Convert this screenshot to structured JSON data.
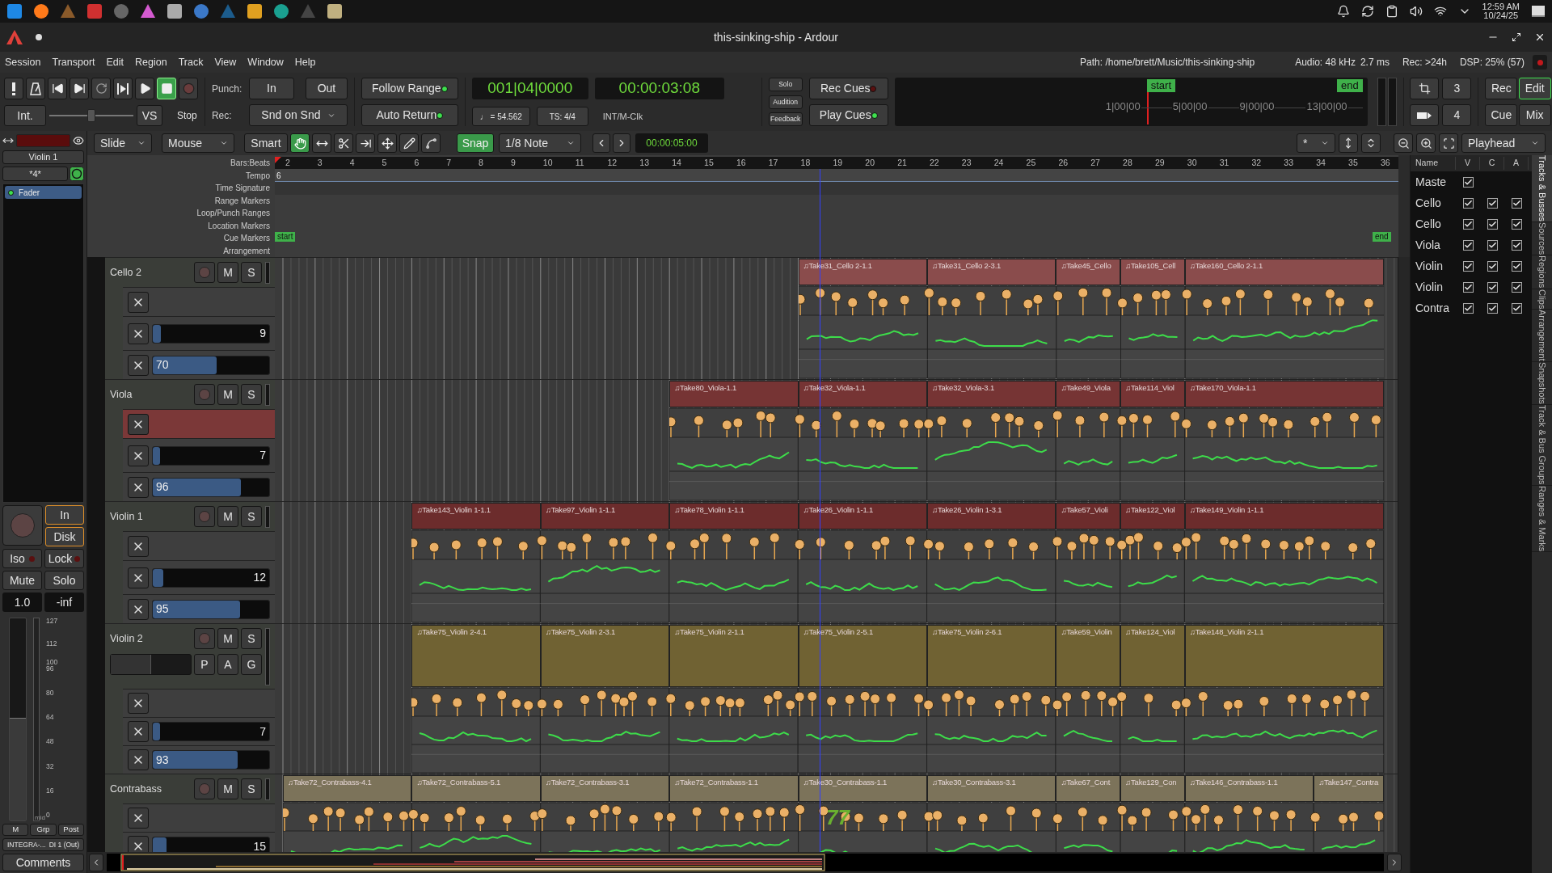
{
  "taskbar": {
    "time": "12:59 AM",
    "date": "10/24/25"
  },
  "window": {
    "title": "this-sinking-ship - Ardour"
  },
  "menu": [
    "Session",
    "Transport",
    "Edit",
    "Region",
    "Track",
    "View",
    "Window",
    "Help"
  ],
  "status": {
    "path": "Path: /home/brett/Music/this-sinking-ship",
    "audio": "Audio: 48 kHz",
    "latency": "2.7 ms",
    "rec": "Rec: >24h",
    "dsp": "DSP: 25% (57)"
  },
  "transport": {
    "buttons": [
      {
        "kind": "panic",
        "active": false
      },
      {
        "kind": "metronome",
        "active": false
      },
      {
        "kind": "to-start",
        "active": false
      },
      {
        "kind": "to-end",
        "active": false
      },
      {
        "kind": "loop",
        "active": false
      },
      {
        "kind": "play-range",
        "active": false
      },
      {
        "kind": "play",
        "active": false
      },
      {
        "kind": "stop",
        "active": true
      },
      {
        "kind": "record",
        "active": false
      }
    ],
    "sync_button": "Int.",
    "shuttle": {
      "level": 0.5
    },
    "vs_button": "VS",
    "shuttle_state": "Stop",
    "punch_label": "Punch:",
    "punch_in": "In",
    "punch_out": "Out",
    "rec_label": "Rec:",
    "rec_mode": "Snd on Snd",
    "follow_range": {
      "label": "Follow Range",
      "on": true
    },
    "auto_return": {
      "label": "Auto Return",
      "on": true
    },
    "primary_clock": "001|04|0000",
    "secondary_clock": "00:00:03:08",
    "tempo": "♩ = 54.562",
    "meter": "TS: 4/4",
    "sync_source": "INT/M-Clk",
    "monitor_buttons": [
      "Solo",
      "Audition",
      "Feedback"
    ],
    "rec_cues": {
      "label": "Rec Cues",
      "on": false
    },
    "play_cues": {
      "label": "Play Cues",
      "on": true
    },
    "mini_timeline": {
      "start": "start",
      "end": "end",
      "ticks": [
        "1|00|00",
        "5|00|00",
        "9|00|00",
        "13|00|00"
      ]
    },
    "slot_buttons": [
      "3",
      "4"
    ],
    "views": [
      {
        "label": "Rec",
        "selected": false
      },
      {
        "label": "Edit",
        "selected": true
      },
      {
        "label": "Cue",
        "selected": false
      },
      {
        "label": "Mix",
        "selected": false
      }
    ]
  },
  "editor_toolbar": {
    "edit_mode": "Slide",
    "edit_point": "Mouse",
    "smart": "Smart",
    "tools": [
      {
        "kind": "grab",
        "selected": true
      },
      {
        "kind": "range",
        "selected": false
      },
      {
        "kind": "cut",
        "selected": false
      },
      {
        "kind": "stretch",
        "selected": false
      },
      {
        "kind": "move",
        "selected": false
      },
      {
        "kind": "draw",
        "selected": false
      },
      {
        "kind": "internal",
        "selected": false
      }
    ],
    "snap": {
      "label": "Snap",
      "on": true
    },
    "grid": "1/8 Note",
    "nudge_clock": "00:00:05:00",
    "visible_tracks": "*",
    "zoom_focus": "Playhead"
  },
  "editor_strip": {
    "name": "Violin 1",
    "input": "*4*",
    "processors": [
      {
        "name": "Fader",
        "selected": true
      }
    ],
    "monitor": [
      {
        "label": "In",
        "on": true
      },
      {
        "label": "Disk",
        "on": true
      }
    ],
    "iso": "Iso",
    "lock": "Lock",
    "mute": "Mute",
    "solo": "Solo",
    "gain": "1.0",
    "peak": "-inf",
    "fader": {
      "level": 0.51
    },
    "meter_scale": [
      "127",
      "112",
      "100",
      "96",
      "80",
      "64",
      "48",
      "32",
      "16",
      "0"
    ],
    "scale_note": "mid",
    "buttons": [
      "M",
      "Grp",
      "Post"
    ],
    "input_name": "INTEGRA-...",
    "output_name": "DI 1 (Out)",
    "comments": "Comments"
  },
  "rulers": {
    "labels": [
      "Bars:Beats",
      "Tempo",
      "Time Signature",
      "Range Markers",
      "Loop/Punch Ranges",
      "Location Markers",
      "Cue Markers",
      "Arrangement"
    ],
    "bars": [
      "2",
      "3",
      "4",
      "5",
      "6",
      "7",
      "8",
      "9",
      "10",
      "11",
      "12",
      "13",
      "14",
      "15",
      "16",
      "17",
      "18",
      "19",
      "20",
      "21",
      "22",
      "23",
      "24",
      "25",
      "26",
      "27",
      "28",
      "29",
      "30",
      "31",
      "32",
      "33",
      "34",
      "35",
      "36"
    ],
    "tempo_value": "6",
    "start_marker": "start",
    "end_marker": "end"
  },
  "tracks": [
    {
      "name": "Cello 2",
      "color": "#8a4c4c",
      "buttons": [
        "M",
        "S"
      ],
      "regions": [
        "♫Take31_Cello 2-1.1",
        "♫Take31_Cello 2-3.1",
        "♫Take45_Cello",
        "♫Take105_Cell",
        "♫Take160_Cello 2-1.1"
      ],
      "lanes": [
        {
          "kind": "velocity",
          "selected": false
        },
        {
          "kind": "cc-curve",
          "value": "9",
          "level": 0.07,
          "selected": false
        },
        {
          "kind": "cc-flat",
          "value": "70",
          "level": 0.55,
          "selected": false
        }
      ]
    },
    {
      "name": "Viola",
      "color": "#763434",
      "buttons": [
        "M",
        "S"
      ],
      "regions": [
        "♫Take80_Viola-1.1",
        "♫Take32_Viola-1.1",
        "♫Take32_Viola-3.1",
        "♫Take49_Viola",
        "♫Take114_Viol",
        "♫Take170_Viola-1.1"
      ],
      "lanes": [
        {
          "kind": "velocity",
          "selected": true
        },
        {
          "kind": "cc-curve",
          "value": "7",
          "level": 0.055,
          "selected": false
        },
        {
          "kind": "cc-flat",
          "value": "96",
          "level": 0.76,
          "selected": false
        }
      ]
    },
    {
      "name": "Violin 1",
      "color": "#6c2c2c",
      "buttons": [
        "M",
        "S"
      ],
      "regions": [
        "♫Take143_Violin 1-1.1",
        "♫Take97_Violin 1-1.1",
        "♫Take78_Violin 1-1.1",
        "♫Take26_Violin 1-1.1",
        "♫Take26_Violin 1-3.1",
        "♫Take57_Violi",
        "♫Take122_Viol",
        "♫Take149_Violin 1-1.1"
      ],
      "lanes": [
        {
          "kind": "velocity",
          "selected": false
        },
        {
          "kind": "cc-curve",
          "value": "12",
          "level": 0.09,
          "selected": false
        },
        {
          "kind": "cc-flat",
          "value": "95",
          "level": 0.75,
          "selected": false
        }
      ]
    },
    {
      "name": "Violin 2",
      "color": "#706233",
      "buttons": [
        "M",
        "S"
      ],
      "pan": {
        "level": 0.5
      },
      "extra_buttons": [
        "P",
        "A",
        "G"
      ],
      "regions": [
        "♫Take75_Violin 2-4.1",
        "♫Take75_Violin 2-3.1",
        "♫Take75_Violin 2-1.1",
        "♫Take75_Violin 2-5.1",
        "♫Take75_Violin 2-6.1",
        "♫Take59_Violin",
        "♫Take124_Viol",
        "♫Take148_Violin 2-1.1"
      ],
      "lanes": [
        {
          "kind": "velocity",
          "selected": false
        },
        {
          "kind": "cc-curve",
          "value": "7",
          "level": 0.055,
          "selected": false
        },
        {
          "kind": "cc-flat",
          "value": "93",
          "level": 0.73,
          "selected": false
        }
      ]
    },
    {
      "name": "Contrabass",
      "color": "#7c735a",
      "buttons": [
        "M",
        "S"
      ],
      "velocity_tip": "77",
      "regions": [
        "♫Take72_Contrabass-4.1",
        "♫Take72_Contrabass-5.1",
        "♫Take72_Contrabass-3.1",
        "♫Take72_Contrabass-1.1",
        "♫Take30_Contrabass-1.1",
        "♫Take30_Contrabass-3.1",
        "♫Take67_Cont",
        "♫Take129_Con",
        "♫Take146_Contrabass-1.1",
        "♫Take147_Contra"
      ],
      "lanes": [
        {
          "kind": "velocity",
          "selected": false
        },
        {
          "kind": "cc-curve",
          "value": "15",
          "level": 0.12,
          "selected": false
        }
      ]
    }
  ],
  "track_list": {
    "columns": [
      "Name",
      "V",
      "C",
      "A"
    ],
    "rows": [
      {
        "name": "Maste",
        "v": true
      },
      {
        "name": "Cello",
        "v": true,
        "c": true,
        "a": true
      },
      {
        "name": "Cello",
        "v": true,
        "c": true,
        "a": true
      },
      {
        "name": "Viola",
        "v": true,
        "c": true,
        "a": true
      },
      {
        "name": "Violin",
        "v": true,
        "c": true,
        "a": true
      },
      {
        "name": "Violin",
        "v": true,
        "c": true,
        "a": true
      },
      {
        "name": "Contra",
        "v": true,
        "c": true,
        "a": true
      }
    ]
  },
  "side_tabs": [
    {
      "label": "Tracks & Busses",
      "selected": true
    },
    {
      "label": "Sources",
      "selected": false
    },
    {
      "label": "Regions",
      "selected": false
    },
    {
      "label": "Clips",
      "selected": false
    },
    {
      "label": "Arrangement",
      "selected": false
    },
    {
      "label": "Snapshots",
      "selected": false
    },
    {
      "label": "Track & Bus Groups",
      "selected": false
    },
    {
      "label": "Ranges & Marks",
      "selected": false
    }
  ]
}
